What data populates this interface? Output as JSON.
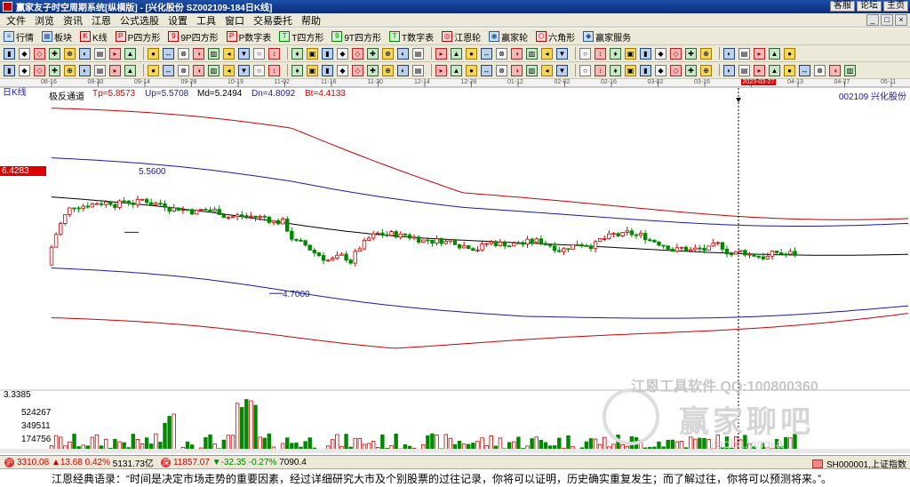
{
  "window": {
    "title": "赢家友子时空周期系统[纵横版] - [兴化股份  SZ002109-184日K线]",
    "top_buttons": [
      "客服",
      "论坛",
      "主页"
    ],
    "controls": [
      "_",
      "□",
      "×"
    ]
  },
  "menu": [
    "文件",
    "浏览",
    "资讯",
    "江恩",
    "公式选股",
    "设置",
    "工具",
    "窗口",
    "交易委托",
    "帮助"
  ],
  "toolbar1": [
    {
      "icon": "list-icon",
      "label": "行情"
    },
    {
      "icon": "grid-icon",
      "label": "板块"
    },
    {
      "icon": "candlestick-icon",
      "label": "K线"
    },
    {
      "icon": "p-square-icon",
      "label": "P四方形"
    },
    {
      "icon": "9p-square-icon",
      "label": "9P四方形"
    },
    {
      "icon": "p-number-icon",
      "label": "P数字表"
    },
    {
      "icon": "t-square-icon",
      "label": "T四方形"
    },
    {
      "icon": "9t-square-icon",
      "label": "9T四方形"
    },
    {
      "icon": "t-number-icon",
      "label": "T数字表"
    },
    {
      "icon": "gann-wheel-icon",
      "label": "江恩轮"
    },
    {
      "icon": "winner-wheel-icon",
      "label": "赢家轮"
    },
    {
      "icon": "hexagon-icon",
      "label": "六角形"
    },
    {
      "icon": "service-icon",
      "label": "赢家服务"
    }
  ],
  "chart": {
    "period_label": "日K线",
    "indicator_name": "极反通道",
    "tp": "Tp=5.8573",
    "up": "Up=5.5708",
    "md": "Md=5.2494",
    "dn": "Dn=4.8092",
    "bt": "Bt=4.4133",
    "stock": "002109 兴化股份",
    "price_marker": "6.4283",
    "annotation_high": "5.5600",
    "annotation_low": "4.7000",
    "date_ticks": [
      "08-16",
      "08-30",
      "09-14",
      "09-28",
      "10-19",
      "11-02",
      "11-16",
      "11-30",
      "12-14",
      "12-28",
      "01-12",
      "02-02",
      "02-16",
      "03-02",
      "03-16",
      "2023-03-27",
      "04-13",
      "04-27",
      "05-11"
    ],
    "volume_ticks": [
      "3.3385",
      "524267",
      "349511",
      "174756"
    ],
    "watermark_line1": "江恩工具软件  QQ:100800360",
    "watermark_line2": "赢家聊吧",
    "watermark_line3": "jiaoba.yingjia"
  },
  "chart_data": {
    "type": "candlestick",
    "price_range": [
      3.3385,
      6.4283
    ],
    "bands": [
      "Tp",
      "Up",
      "Md",
      "Dn",
      "Bt"
    ],
    "band_colors": {
      "Tp": "#cc0000",
      "Up": "#1a1aa8",
      "Md": "#000000",
      "Dn": "#1a1aa8",
      "Bt": "#cc0000"
    },
    "annotations": [
      {
        "label": "5.5600",
        "value": 5.56
      },
      {
        "label": "4.7000",
        "value": 4.7
      }
    ]
  },
  "status": {
    "sh_index": "3310.08",
    "sh_change": "▲13.68",
    "sh_pct": "0.42%",
    "sh_amount": "5131.73亿",
    "sz_index": "11857.07",
    "sz_change": "▼-32.35",
    "sz_pct": "-0.27%",
    "sz_amount": "7090.4",
    "right_label": "SH000001,上证指数"
  },
  "quote": "江恩经典语录：“时间是决定市场走势的重要因素，经过详细研究大市及个别股票的过往记录，你将可以证明，历史确实重复发生；而了解过往，你将可以预测将来。”。",
  "colors": {
    "up": "#cc0000",
    "down": "#008800",
    "band_outer": "#cc0000",
    "band_inner": "#1a1aa8"
  }
}
